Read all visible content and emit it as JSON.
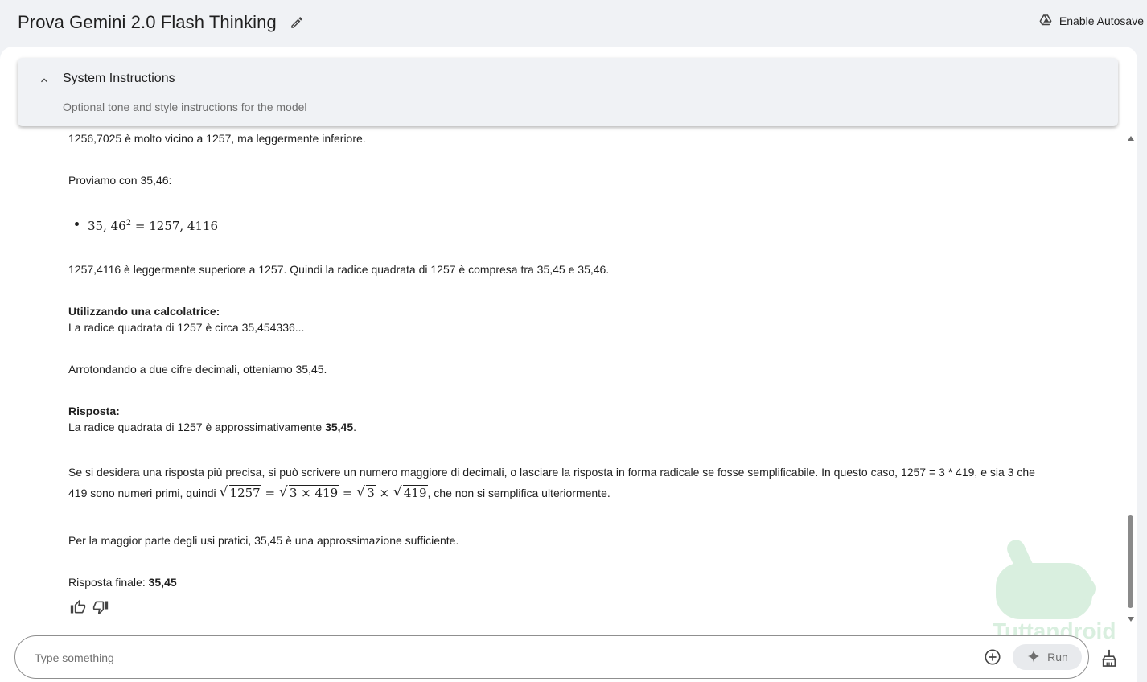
{
  "header": {
    "title": "Prova Gemini 2.0 Flash Thinking",
    "autosave_label": "Enable Autosave"
  },
  "system_instructions": {
    "label": "System Instructions",
    "placeholder": "Optional tone and style instructions for the model"
  },
  "response": {
    "l1": "1256,7025 è molto vicino a 1257, ma leggermente inferiore.",
    "l2": "Proviamo con 35,46:",
    "bullet_base": "35, 46",
    "bullet_exp": "2",
    "bullet_eq": "= 1257, 4116",
    "l3": "1257,4116 è leggermente superiore a 1257. Quindi la radice quadrata di 1257 è compresa tra 35,45 e 35,46.",
    "calc_heading": "Utilizzando una calcolatrice:",
    "calc_text": "La radice quadrata di 1257 è circa 35,454336...",
    "round_text": "Arrotondando a due cifre decimali, otteniamo 35,45.",
    "answer_heading": "Risposta:",
    "answer_prefix": "La radice quadrata di 1257 è approssimativamente ",
    "answer_value": "35,45",
    "answer_suffix": ".",
    "precise_line1": "Se si desidera una risposta più precisa, si può scrivere un numero maggiore di decimali, o lasciare la risposta in forma radicale se fosse semplificabile. In questo caso, 1257 = 3 * 419, e sia 3 che",
    "precise_line2_prefix": "419 sono numeri primi, quindi ",
    "math_sqrt1": "1257",
    "math_eq1": " = ",
    "math_sqrt2": "3 × 419",
    "math_eq2": " = ",
    "math_sqrt3": "3",
    "math_times": " × ",
    "math_sqrt4": "419",
    "precise_line2_suffix": ", che non si semplifica ulteriormente.",
    "practical": "Per la maggior parte degli usi pratici, 35,45 è una approssimazione sufficiente.",
    "final_prefix": "Risposta finale: ",
    "final_value": "35,45"
  },
  "input": {
    "placeholder": "Type something",
    "run_label": "Run"
  },
  "icons": {
    "edit": "pencil-icon",
    "autosave": "drive-icon",
    "collapse": "chevron-up-icon",
    "thumbs_up": "thumbs-up-icon",
    "thumbs_down": "thumbs-down-icon",
    "add": "add-circle-icon",
    "run": "sparkle-icon",
    "clear": "broom-icon"
  },
  "colors": {
    "background": "#f0f2f5",
    "panel": "#ffffff",
    "text": "#1f1f1f",
    "muted": "#6f6f6f",
    "watermark": "#34a853"
  }
}
